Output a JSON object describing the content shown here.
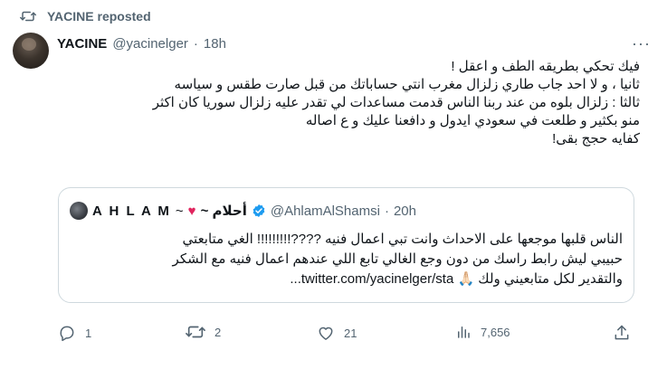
{
  "repost": {
    "label": "YACINE reposted",
    "icon": "repost-icon"
  },
  "tweet": {
    "author_name": "YACINE",
    "author_handle": "@yacinelger",
    "separator": "·",
    "time": "18h",
    "more_label": "···",
    "lines": [
      "فيك تحكي بطريقه الطف و اعقل !",
      "ثانيا ، و لا احد جاب طاري زلزال مغرب انتي حساباتك من قبل صارت طقس و سياسه",
      "ثالثا : زلزال بلوه من عند ربنا الناس قدمت مساعدات لي تقدر عليه زلزال سوريا كان اكثر",
      "منو بكثير و طلعت في سعودي ايدول و دافعنا عليك و ع اصاله",
      "كفايه حجج بقى!"
    ]
  },
  "quote": {
    "name": "A H L A M",
    "name_suffix": "~",
    "heart": "♥",
    "arabic_name": "~ أحلام",
    "handle": "@AhlamAlShamsi",
    "separator": "·",
    "time": "20h",
    "lines": [
      "الناس قلبها موجعها على الاحداث وانت تبي اعمال فنيه ????!!!!!!!!! الغي متابعتي",
      "حبيبي ليش رابط راسك من دون وجع الغالي تابع اللي عندهم اعمال فنيه مع الشكر",
      "والتقدير لكل متابعيني ولك 🙏🏻 twitter.com/yacinelger/sta..."
    ]
  },
  "actions": {
    "replies": "1",
    "reposts": "2",
    "likes": "21",
    "views": "7,656"
  },
  "colors": {
    "text": "#0f1419",
    "secondary": "#536471",
    "verified": "#1d9bf0",
    "border": "#cfd9de",
    "heart": "#e0245e"
  }
}
